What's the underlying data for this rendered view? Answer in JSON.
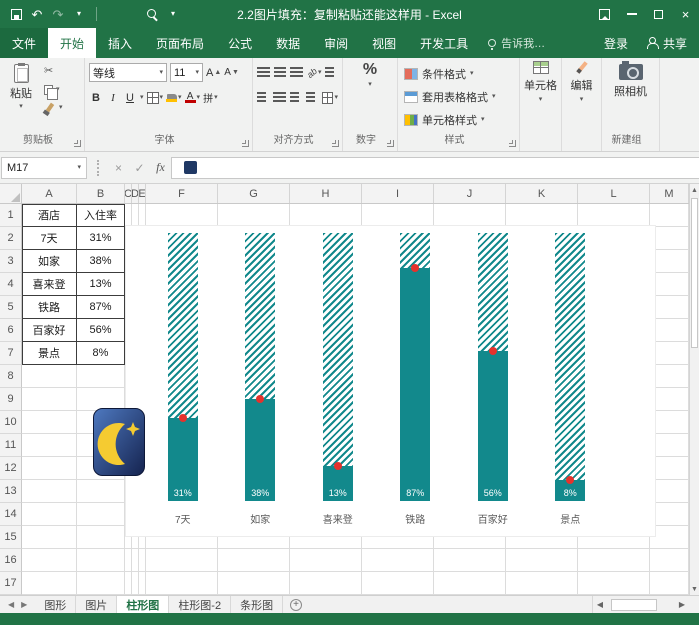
{
  "colors": {
    "excel_green": "#217346",
    "bar_teal": "#12898C",
    "marker_red": "#E5322D",
    "moon_yellow": "#F5CB31"
  },
  "title_bar": {
    "title": "2.2图片填充：复制粘贴还能这样用 - Excel"
  },
  "ribbon_tabs": [
    {
      "label": "文件",
      "file": true
    },
    {
      "label": "开始",
      "active": true
    },
    {
      "label": "插入"
    },
    {
      "label": "页面布局"
    },
    {
      "label": "公式"
    },
    {
      "label": "数据"
    },
    {
      "label": "审阅"
    },
    {
      "label": "视图"
    },
    {
      "label": "开发工具"
    },
    {
      "label": "告诉我…",
      "hint": true
    }
  ],
  "account": {
    "sign_in": "登录",
    "share": "共享"
  },
  "ribbon": {
    "clipboard": {
      "label": "剪贴板",
      "paste": "粘贴"
    },
    "font": {
      "label": "字体",
      "name": "等线",
      "size": "11",
      "bold": "B",
      "italic": "I",
      "underline": "U",
      "grow": "A",
      "shrink": "A",
      "phonetic": "拼",
      "orientation": "ab"
    },
    "alignment": {
      "label": "对齐方式"
    },
    "number": {
      "label": "数字",
      "percent": "%"
    },
    "styles": {
      "label": "样式",
      "items": [
        "条件格式",
        "套用表格格式",
        "单元格样式"
      ]
    },
    "cells": {
      "label": "单元格"
    },
    "editing": {
      "label": "编辑"
    },
    "new_group": {
      "label": "新建组",
      "camera": "照相机"
    }
  },
  "formula_bar": {
    "name_box": "M17",
    "cancel": "×",
    "enter": "✓",
    "fx": "fx"
  },
  "grid": {
    "column_headers": [
      "A",
      "B",
      "C",
      "D",
      "E",
      "F",
      "G",
      "H",
      "I",
      "J",
      "K",
      "L",
      "M"
    ],
    "rows": 17,
    "table": {
      "headers": [
        "酒店",
        "入住率"
      ],
      "data": [
        [
          "7天",
          "31%"
        ],
        [
          "如家",
          "38%"
        ],
        [
          "喜来登",
          "13%"
        ],
        [
          "铁路",
          "87%"
        ],
        [
          "百家好",
          "56%"
        ],
        [
          "景点",
          "8%"
        ]
      ]
    }
  },
  "chart_data": {
    "type": "bar",
    "title": "",
    "categories": [
      "7天",
      "如家",
      "喜来登",
      "铁路",
      "百家好",
      "景点"
    ],
    "values": [
      31,
      38,
      13,
      87,
      56,
      8
    ],
    "value_labels": [
      "31%",
      "38%",
      "13%",
      "87%",
      "56%",
      "8%"
    ],
    "ylim": [
      0,
      100
    ],
    "bar_color": "#12898C",
    "remainder_fill": "diagonal-stripes-to-100%",
    "marker": "red-dot-at-value-top",
    "marker_color": "#E5322D",
    "legend": "none",
    "grid": false,
    "axes_visible": false
  },
  "sheet_tabs": {
    "tabs": [
      {
        "label": "图形"
      },
      {
        "label": "图片"
      },
      {
        "label": "柱形图",
        "active": true
      },
      {
        "label": "柱形图-2"
      },
      {
        "label": "条形图"
      }
    ]
  },
  "icons": {
    "dropdown": "▾",
    "undo": "↶",
    "redo": "↷",
    "close": "×",
    "check": "✓",
    "cut": "✂",
    "left": "◀",
    "right": "▶",
    "up": "▲",
    "down": "▼",
    "plus": "+",
    "fx": "fx"
  }
}
